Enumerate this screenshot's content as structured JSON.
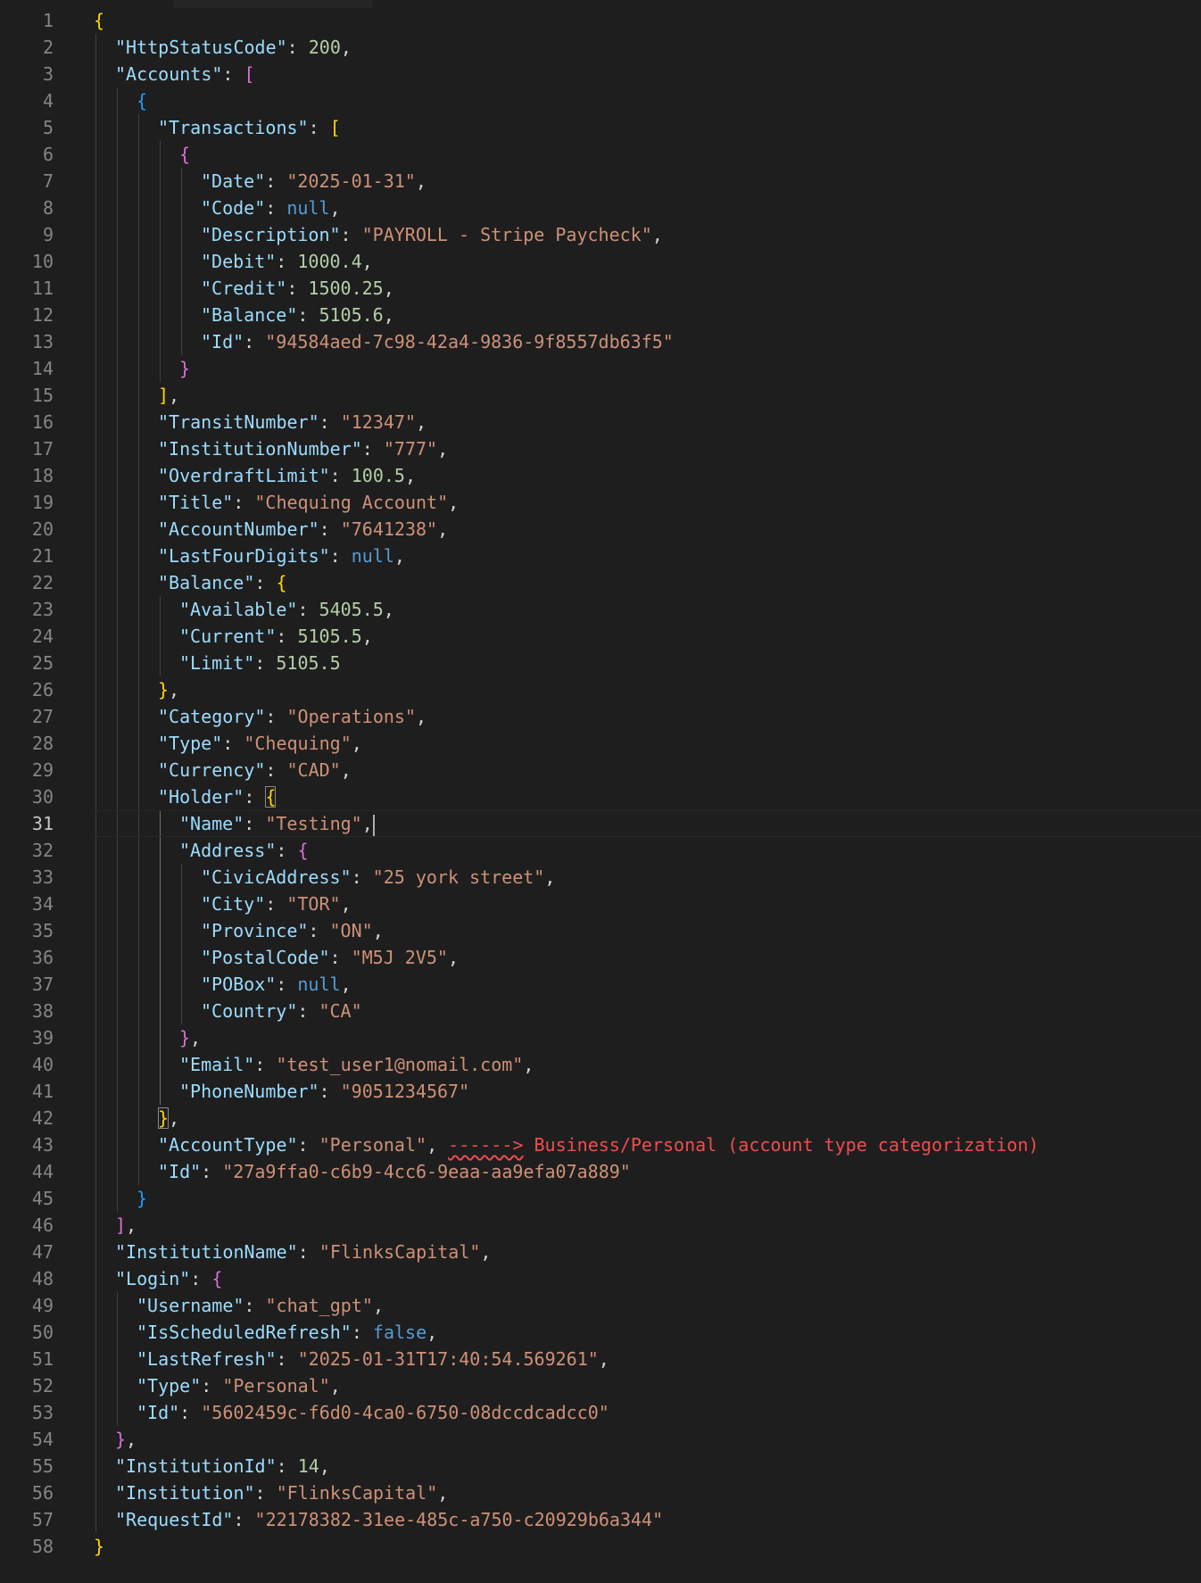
{
  "editor": {
    "current_line": 31,
    "lines": [
      {
        "n": "1",
        "ind": 0,
        "t": [
          [
            "b1",
            "{"
          ]
        ]
      },
      {
        "n": "2",
        "ind": 1,
        "t": [
          [
            "k",
            "\"HttpStatusCode\""
          ],
          [
            "p",
            ": "
          ],
          [
            "n",
            "200"
          ],
          [
            "p",
            ","
          ]
        ]
      },
      {
        "n": "3",
        "ind": 1,
        "t": [
          [
            "k",
            "\"Accounts\""
          ],
          [
            "p",
            ": "
          ],
          [
            "b2",
            "["
          ]
        ]
      },
      {
        "n": "4",
        "ind": 2,
        "t": [
          [
            "b3",
            "{"
          ]
        ]
      },
      {
        "n": "5",
        "ind": 3,
        "t": [
          [
            "k",
            "\"Transactions\""
          ],
          [
            "p",
            ": "
          ],
          [
            "b1",
            "["
          ]
        ]
      },
      {
        "n": "6",
        "ind": 4,
        "t": [
          [
            "b2",
            "{"
          ]
        ]
      },
      {
        "n": "7",
        "ind": 5,
        "t": [
          [
            "k",
            "\"Date\""
          ],
          [
            "p",
            ": "
          ],
          [
            "s",
            "\"2025-01-31\""
          ],
          [
            "p",
            ","
          ]
        ]
      },
      {
        "n": "8",
        "ind": 5,
        "t": [
          [
            "k",
            "\"Code\""
          ],
          [
            "p",
            ": "
          ],
          [
            "kw",
            "null"
          ],
          [
            "p",
            ","
          ]
        ]
      },
      {
        "n": "9",
        "ind": 5,
        "t": [
          [
            "k",
            "\"Description\""
          ],
          [
            "p",
            ": "
          ],
          [
            "s",
            "\"PAYROLL - Stripe Paycheck\""
          ],
          [
            "p",
            ","
          ]
        ]
      },
      {
        "n": "10",
        "ind": 5,
        "t": [
          [
            "k",
            "\"Debit\""
          ],
          [
            "p",
            ": "
          ],
          [
            "n",
            "1000.4"
          ],
          [
            "p",
            ","
          ]
        ]
      },
      {
        "n": "11",
        "ind": 5,
        "t": [
          [
            "k",
            "\"Credit\""
          ],
          [
            "p",
            ": "
          ],
          [
            "n",
            "1500.25"
          ],
          [
            "p",
            ","
          ]
        ]
      },
      {
        "n": "12",
        "ind": 5,
        "t": [
          [
            "k",
            "\"Balance\""
          ],
          [
            "p",
            ": "
          ],
          [
            "n",
            "5105.6"
          ],
          [
            "p",
            ","
          ]
        ]
      },
      {
        "n": "13",
        "ind": 5,
        "t": [
          [
            "k",
            "\"Id\""
          ],
          [
            "p",
            ": "
          ],
          [
            "s",
            "\"94584aed-7c98-42a4-9836-9f8557db63f5\""
          ]
        ]
      },
      {
        "n": "14",
        "ind": 4,
        "t": [
          [
            "b2",
            "}"
          ]
        ]
      },
      {
        "n": "15",
        "ind": 3,
        "t": [
          [
            "b1",
            "]"
          ],
          [
            "p",
            ","
          ]
        ]
      },
      {
        "n": "16",
        "ind": 3,
        "t": [
          [
            "k",
            "\"TransitNumber\""
          ],
          [
            "p",
            ": "
          ],
          [
            "s",
            "\"12347\""
          ],
          [
            "p",
            ","
          ]
        ]
      },
      {
        "n": "17",
        "ind": 3,
        "t": [
          [
            "k",
            "\"InstitutionNumber\""
          ],
          [
            "p",
            ": "
          ],
          [
            "s",
            "\"777\""
          ],
          [
            "p",
            ","
          ]
        ]
      },
      {
        "n": "18",
        "ind": 3,
        "t": [
          [
            "k",
            "\"OverdraftLimit\""
          ],
          [
            "p",
            ": "
          ],
          [
            "n",
            "100.5"
          ],
          [
            "p",
            ","
          ]
        ]
      },
      {
        "n": "19",
        "ind": 3,
        "t": [
          [
            "k",
            "\"Title\""
          ],
          [
            "p",
            ": "
          ],
          [
            "s",
            "\"Chequing Account\""
          ],
          [
            "p",
            ","
          ]
        ]
      },
      {
        "n": "20",
        "ind": 3,
        "t": [
          [
            "k",
            "\"AccountNumber\""
          ],
          [
            "p",
            ": "
          ],
          [
            "s",
            "\"7641238\""
          ],
          [
            "p",
            ","
          ]
        ]
      },
      {
        "n": "21",
        "ind": 3,
        "t": [
          [
            "k",
            "\"LastFourDigits\""
          ],
          [
            "p",
            ": "
          ],
          [
            "kw",
            "null"
          ],
          [
            "p",
            ","
          ]
        ]
      },
      {
        "n": "22",
        "ind": 3,
        "t": [
          [
            "k",
            "\"Balance\""
          ],
          [
            "p",
            ": "
          ],
          [
            "b1",
            "{"
          ]
        ]
      },
      {
        "n": "23",
        "ind": 4,
        "t": [
          [
            "k",
            "\"Available\""
          ],
          [
            "p",
            ": "
          ],
          [
            "n",
            "5405.5"
          ],
          [
            "p",
            ","
          ]
        ]
      },
      {
        "n": "24",
        "ind": 4,
        "t": [
          [
            "k",
            "\"Current\""
          ],
          [
            "p",
            ": "
          ],
          [
            "n",
            "5105.5"
          ],
          [
            "p",
            ","
          ]
        ]
      },
      {
        "n": "25",
        "ind": 4,
        "t": [
          [
            "k",
            "\"Limit\""
          ],
          [
            "p",
            ": "
          ],
          [
            "n",
            "5105.5"
          ]
        ]
      },
      {
        "n": "26",
        "ind": 3,
        "t": [
          [
            "b1",
            "}"
          ],
          [
            "p",
            ","
          ]
        ]
      },
      {
        "n": "27",
        "ind": 3,
        "t": [
          [
            "k",
            "\"Category\""
          ],
          [
            "p",
            ": "
          ],
          [
            "s",
            "\"Operations\""
          ],
          [
            "p",
            ","
          ]
        ]
      },
      {
        "n": "28",
        "ind": 3,
        "t": [
          [
            "k",
            "\"Type\""
          ],
          [
            "p",
            ": "
          ],
          [
            "s",
            "\"Chequing\""
          ],
          [
            "p",
            ","
          ]
        ]
      },
      {
        "n": "29",
        "ind": 3,
        "t": [
          [
            "k",
            "\"Currency\""
          ],
          [
            "p",
            ": "
          ],
          [
            "s",
            "\"CAD\""
          ],
          [
            "p",
            ","
          ]
        ]
      },
      {
        "n": "30",
        "ind": 3,
        "t": [
          [
            "k",
            "\"Holder\""
          ],
          [
            "p",
            ": "
          ],
          [
            "b1 bm",
            "{"
          ]
        ]
      },
      {
        "n": "31",
        "ind": 4,
        "t": [
          [
            "k",
            "\"Name\""
          ],
          [
            "p",
            ": "
          ],
          [
            "s",
            "\"Testing\""
          ],
          [
            "p",
            ","
          ],
          [
            "cursor",
            ""
          ]
        ]
      },
      {
        "n": "32",
        "ind": 4,
        "t": [
          [
            "k",
            "\"Address\""
          ],
          [
            "p",
            ": "
          ],
          [
            "b2",
            "{"
          ]
        ]
      },
      {
        "n": "33",
        "ind": 5,
        "t": [
          [
            "k",
            "\"CivicAddress\""
          ],
          [
            "p",
            ": "
          ],
          [
            "s",
            "\"25 york street\""
          ],
          [
            "p",
            ","
          ]
        ]
      },
      {
        "n": "34",
        "ind": 5,
        "t": [
          [
            "k",
            "\"City\""
          ],
          [
            "p",
            ": "
          ],
          [
            "s",
            "\"TOR\""
          ],
          [
            "p",
            ","
          ]
        ]
      },
      {
        "n": "35",
        "ind": 5,
        "t": [
          [
            "k",
            "\"Province\""
          ],
          [
            "p",
            ": "
          ],
          [
            "s",
            "\"ON\""
          ],
          [
            "p",
            ","
          ]
        ]
      },
      {
        "n": "36",
        "ind": 5,
        "t": [
          [
            "k",
            "\"PostalCode\""
          ],
          [
            "p",
            ": "
          ],
          [
            "s",
            "\"M5J 2V5\""
          ],
          [
            "p",
            ","
          ]
        ]
      },
      {
        "n": "37",
        "ind": 5,
        "t": [
          [
            "k",
            "\"POBox\""
          ],
          [
            "p",
            ": "
          ],
          [
            "kw",
            "null"
          ],
          [
            "p",
            ","
          ]
        ]
      },
      {
        "n": "38",
        "ind": 5,
        "t": [
          [
            "k",
            "\"Country\""
          ],
          [
            "p",
            ": "
          ],
          [
            "s",
            "\"CA\""
          ]
        ]
      },
      {
        "n": "39",
        "ind": 4,
        "t": [
          [
            "b2",
            "}"
          ],
          [
            "p",
            ","
          ]
        ]
      },
      {
        "n": "40",
        "ind": 4,
        "t": [
          [
            "k",
            "\"Email\""
          ],
          [
            "p",
            ": "
          ],
          [
            "s",
            "\"test_user1@nomail.com\""
          ],
          [
            "p",
            ","
          ]
        ]
      },
      {
        "n": "41",
        "ind": 4,
        "t": [
          [
            "k",
            "\"PhoneNumber\""
          ],
          [
            "p",
            ": "
          ],
          [
            "s",
            "\"9051234567\""
          ]
        ]
      },
      {
        "n": "42",
        "ind": 3,
        "t": [
          [
            "b1 bm",
            "}"
          ],
          [
            "p",
            ","
          ]
        ]
      },
      {
        "n": "43",
        "ind": 3,
        "t": [
          [
            "k",
            "\"AccountType\""
          ],
          [
            "p",
            ": "
          ],
          [
            "s",
            "\"Personal\""
          ],
          [
            "p",
            ", "
          ],
          [
            "err squiggle",
            "------>"
          ],
          [
            "err",
            " Business/Personal (account type categorization)"
          ]
        ]
      },
      {
        "n": "44",
        "ind": 3,
        "t": [
          [
            "k",
            "\"Id\""
          ],
          [
            "p",
            ": "
          ],
          [
            "s",
            "\"27a9ffa0-c6b9-4cc6-9eaa-aa9efa07a889\""
          ]
        ]
      },
      {
        "n": "45",
        "ind": 2,
        "t": [
          [
            "b3",
            "}"
          ]
        ]
      },
      {
        "n": "46",
        "ind": 1,
        "t": [
          [
            "b2",
            "]"
          ],
          [
            "p",
            ","
          ]
        ]
      },
      {
        "n": "47",
        "ind": 1,
        "t": [
          [
            "k",
            "\"InstitutionName\""
          ],
          [
            "p",
            ": "
          ],
          [
            "s",
            "\"FlinksCapital\""
          ],
          [
            "p",
            ","
          ]
        ]
      },
      {
        "n": "48",
        "ind": 1,
        "t": [
          [
            "k",
            "\"Login\""
          ],
          [
            "p",
            ": "
          ],
          [
            "b2",
            "{"
          ]
        ]
      },
      {
        "n": "49",
        "ind": 2,
        "t": [
          [
            "k",
            "\"Username\""
          ],
          [
            "p",
            ": "
          ],
          [
            "s",
            "\"chat_gpt\""
          ],
          [
            "p",
            ","
          ]
        ]
      },
      {
        "n": "50",
        "ind": 2,
        "t": [
          [
            "k",
            "\"IsScheduledRefresh\""
          ],
          [
            "p",
            ": "
          ],
          [
            "kw",
            "false"
          ],
          [
            "p",
            ","
          ]
        ]
      },
      {
        "n": "51",
        "ind": 2,
        "t": [
          [
            "k",
            "\"LastRefresh\""
          ],
          [
            "p",
            ": "
          ],
          [
            "s",
            "\"2025-01-31T17:40:54.569261\""
          ],
          [
            "p",
            ","
          ]
        ]
      },
      {
        "n": "52",
        "ind": 2,
        "t": [
          [
            "k",
            "\"Type\""
          ],
          [
            "p",
            ": "
          ],
          [
            "s",
            "\"Personal\""
          ],
          [
            "p",
            ","
          ]
        ]
      },
      {
        "n": "53",
        "ind": 2,
        "t": [
          [
            "k",
            "\"Id\""
          ],
          [
            "p",
            ": "
          ],
          [
            "s",
            "\"5602459c-f6d0-4ca0-6750-08dccdcadcc0\""
          ]
        ]
      },
      {
        "n": "54",
        "ind": 1,
        "t": [
          [
            "b2",
            "}"
          ],
          [
            "p",
            ","
          ]
        ]
      },
      {
        "n": "55",
        "ind": 1,
        "t": [
          [
            "k",
            "\"InstitutionId\""
          ],
          [
            "p",
            ": "
          ],
          [
            "n",
            "14"
          ],
          [
            "p",
            ","
          ]
        ]
      },
      {
        "n": "56",
        "ind": 1,
        "t": [
          [
            "k",
            "\"Institution\""
          ],
          [
            "p",
            ": "
          ],
          [
            "s",
            "\"FlinksCapital\""
          ],
          [
            "p",
            ","
          ]
        ]
      },
      {
        "n": "57",
        "ind": 1,
        "t": [
          [
            "k",
            "\"RequestId\""
          ],
          [
            "p",
            ": "
          ],
          [
            "s",
            "\"22178382-31ee-485c-a750-c20929b6a344\""
          ]
        ]
      },
      {
        "n": "58",
        "ind": 0,
        "t": [
          [
            "b1",
            "}"
          ]
        ]
      }
    ]
  }
}
